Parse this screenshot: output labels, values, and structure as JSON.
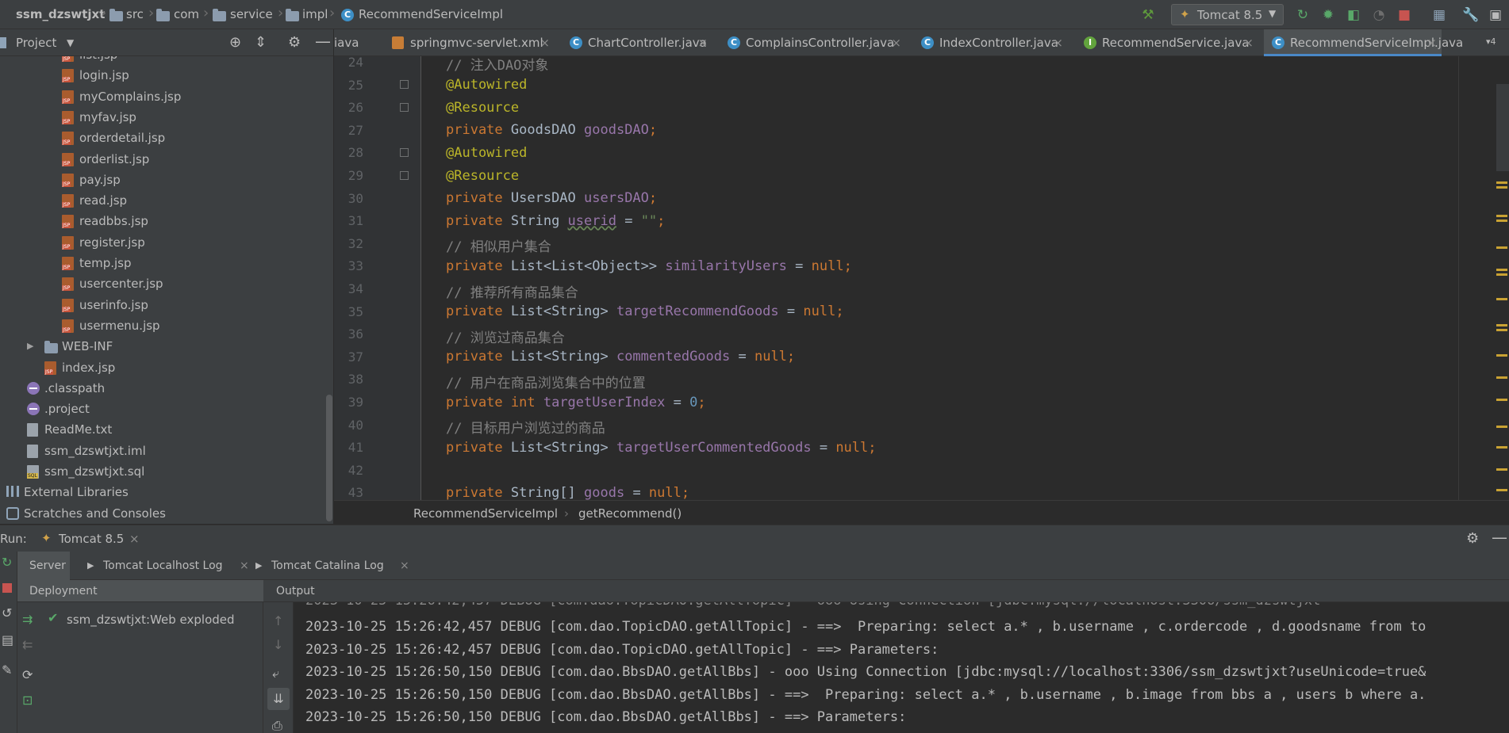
{
  "navbar": {
    "project": "ssm_dzswtjxt",
    "crumbs": [
      "src",
      "com",
      "service",
      "impl"
    ],
    "file": "RecommendServiceImpl",
    "run_config": "Tomcat 8.5"
  },
  "project_panel": {
    "title": "Project",
    "tree": [
      {
        "label": "list.jsp",
        "icon": "jsp"
      },
      {
        "label": "login.jsp",
        "icon": "jsp"
      },
      {
        "label": "myComplains.jsp",
        "icon": "jsp"
      },
      {
        "label": "myfav.jsp",
        "icon": "jsp"
      },
      {
        "label": "orderdetail.jsp",
        "icon": "jsp"
      },
      {
        "label": "orderlist.jsp",
        "icon": "jsp"
      },
      {
        "label": "pay.jsp",
        "icon": "jsp"
      },
      {
        "label": "read.jsp",
        "icon": "jsp"
      },
      {
        "label": "readbbs.jsp",
        "icon": "jsp"
      },
      {
        "label": "register.jsp",
        "icon": "jsp"
      },
      {
        "label": "temp.jsp",
        "icon": "jsp"
      },
      {
        "label": "usercenter.jsp",
        "icon": "jsp"
      },
      {
        "label": "userinfo.jsp",
        "icon": "jsp"
      },
      {
        "label": "usermenu.jsp",
        "icon": "jsp"
      },
      {
        "label": "WEB-INF",
        "icon": "folder"
      },
      {
        "label": "index.jsp",
        "icon": "jsp"
      },
      {
        "label": ".classpath",
        "icon": "dot"
      },
      {
        "label": ".project",
        "icon": "dot"
      },
      {
        "label": "ReadMe.txt",
        "icon": "file"
      },
      {
        "label": "ssm_dzswtjxt.iml",
        "icon": "file"
      },
      {
        "label": "ssm_dzswtjxt.sql",
        "icon": "sql"
      },
      {
        "label": "External Libraries",
        "icon": "lib"
      },
      {
        "label": "Scratches and Consoles",
        "icon": "scratch"
      }
    ]
  },
  "tabs": [
    {
      "label": "iava",
      "icon": "none"
    },
    {
      "label": "springmvc-servlet.xml",
      "icon": "xml"
    },
    {
      "label": "ChartController.java",
      "icon": "class"
    },
    {
      "label": "ComplainsController.java",
      "icon": "class"
    },
    {
      "label": "IndexController.java",
      "icon": "class"
    },
    {
      "label": "RecommendService.java",
      "icon": "interface"
    },
    {
      "label": "RecommendServiceImpl.java",
      "icon": "class"
    }
  ],
  "tabs_overflow": "4",
  "editor": {
    "line_numbers": [
      "24",
      "25",
      "26",
      "27",
      "28",
      "29",
      "30",
      "31",
      "32",
      "33",
      "34",
      "35",
      "36",
      "37",
      "38",
      "39",
      "40",
      "41",
      "42",
      "43"
    ],
    "code": {
      "l24": "// 注入DAO对象",
      "l25": "@Autowired",
      "l26": "@Resource",
      "l27_kw": "private",
      "l27_type": " GoodsDAO ",
      "l27_field": "goodsDAO",
      "l28": "@Autowired",
      "l29": "@Resource",
      "l30_kw": "private",
      "l30_type": " UsersDAO ",
      "l30_field": "usersDAO",
      "l31_kw": "private",
      "l31_type": " String ",
      "l31_field": "userid",
      "l31_eq": " = ",
      "l31_val": "\"\"",
      "l32": "// 相似用户集合",
      "l33_kw": "private",
      "l33_type": " List<List<Object>> ",
      "l33_field": "similarityUsers",
      "l34": "// 推荐所有商品集合",
      "l35_kw": "private",
      "l35_type": " List<String> ",
      "l35_field": "targetRecommendGoods",
      "l36": "// 浏览过商品集合",
      "l37_kw": "private",
      "l37_type": " List<String> ",
      "l37_field": "commentedGoods",
      "l38": "// 用户在商品浏览集合中的位置",
      "l39_kw": "private",
      "l39_kw2": " int",
      "l39_field": " targetUserIndex",
      "l39_eq": " = ",
      "l39_val": "0",
      "l40": "// 目标用户浏览过的商品",
      "l41_kw": "private",
      "l41_type": " List<String> ",
      "l41_field": "targetUserCommentedGoods",
      "l43_kw": "private",
      "l43_type": " String[] ",
      "l43_field": "goods",
      "eq": " = ",
      "null": "null",
      "semi": ";"
    }
  },
  "editor_crumbs": [
    "RecommendServiceImpl",
    "getRecommend()"
  ],
  "run": {
    "label": "Run:",
    "config": "Tomcat 8.5",
    "tabs": [
      "Server",
      "Tomcat Localhost Log",
      "Tomcat Catalina Log"
    ],
    "deployment_header": "Deployment",
    "output_header": "Output",
    "deployment_item": "ssm_dzswtjxt:Web exploded",
    "output_lines": [
      "2023-10-25 15:26:42,457 DEBUG [com.dao.TopicDAO.getAllTopic] - ==>  Preparing: select a.* , b.username , c.ordercode , d.goodsname from to",
      "2023-10-25 15:26:42,457 DEBUG [com.dao.TopicDAO.getAllTopic] - ==> Parameters: ",
      "2023-10-25 15:26:50,150 DEBUG [com.dao.BbsDAO.getAllBbs] - ooo Using Connection [jdbc:mysql://localhost:3306/ssm_dzswtjxt?useUnicode=true&",
      "2023-10-25 15:26:50,150 DEBUG [com.dao.BbsDAO.getAllBbs] - ==>  Preparing: select a.* , b.username , b.image from bbs a , users b where a.",
      "2023-10-25 15:26:50,150 DEBUG [com.dao.BbsDAO.getAllBbs] - ==> Parameters: "
    ]
  },
  "colors": {
    "keyword": "#cc7832",
    "annotation": "#bbb529",
    "field": "#9876aa",
    "comment": "#808080",
    "string": "#6a8759",
    "number": "#6897bb",
    "accent": "#4a88c7"
  }
}
